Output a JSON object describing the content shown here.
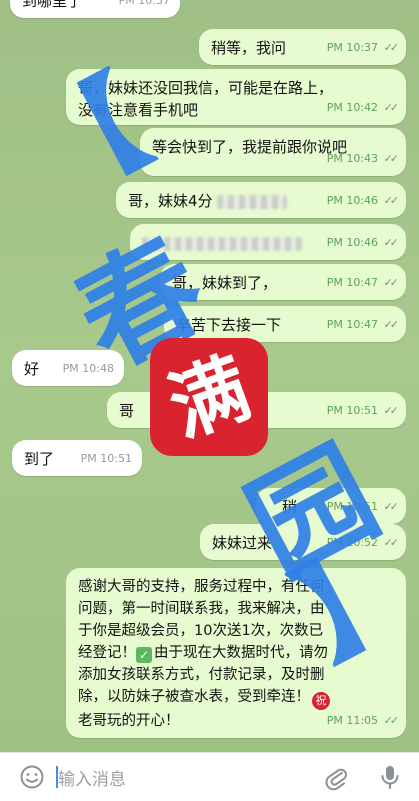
{
  "colors": {
    "outgoing": "#e6fbcf",
    "incoming": "#ffffff",
    "time_outgoing": "#5fa25a",
    "watermark_blue": "#2f7fe6",
    "stamp_red": "#d9232e"
  },
  "messages": [
    {
      "dir": "in",
      "text": "到哪里了",
      "time": "PM 10:37"
    },
    {
      "dir": "out",
      "text": "稍等，我问",
      "time": "PM 10:37"
    },
    {
      "dir": "out",
      "line1": "哥，妹妹还没回我信，可能是在路上，",
      "line2": "没有注意看手机吧",
      "time": "PM 10:42"
    },
    {
      "dir": "out",
      "text": "等会快到了，我提前跟你说吧",
      "time": "PM 10:43"
    },
    {
      "dir": "out",
      "text": "哥，妹妹4分",
      "time": "PM 10:46"
    },
    {
      "dir": "out",
      "text": "",
      "time": "PM 10:46"
    },
    {
      "dir": "out",
      "text": "哥，妹妹到了，",
      "time": "PM 10:47"
    },
    {
      "dir": "out",
      "text": "辛苦下去接一下",
      "time": "PM 10:47"
    },
    {
      "dir": "in",
      "text": "好",
      "time": "PM 10:48"
    },
    {
      "dir": "out",
      "text": "哥",
      "suffix": "了吗?",
      "time": "PM 10:51"
    },
    {
      "dir": "in",
      "text": "到了",
      "time": "PM 10:51"
    },
    {
      "dir": "out",
      "text": "稍",
      "time": "PM 10:51"
    },
    {
      "dir": "out",
      "text": "妹妹过来",
      "time": "PM 10:52"
    },
    {
      "dir": "out",
      "l1": "感谢大哥的支持，服务过程中，有任何",
      "l2": "问题，第一时间联系我，我来解决，由",
      "l3": "于你是超级会员，10次送1次，次数已",
      "l4": "经登记！",
      "l4b": "由于现在大数据时代，请勿",
      "l5": "添加女孩联系方式，付款记录，及时删",
      "l6": "除，以防妹子被查水表，受到牵连！",
      "l7": "老哥玩的开心！",
      "check_emoji": "✓",
      "zhu_emoji": "祝",
      "time": "PM 11:05"
    }
  ],
  "watermark": {
    "bracket_open": "【",
    "char1": "春",
    "char2": "满",
    "char3": "园",
    "bracket_close": "】"
  },
  "input": {
    "placeholder": "输入消息"
  },
  "icons": {
    "emoji": "emoji-icon",
    "attach": "paperclip-icon",
    "mic": "microphone-icon"
  },
  "check_mark": "✓✓"
}
